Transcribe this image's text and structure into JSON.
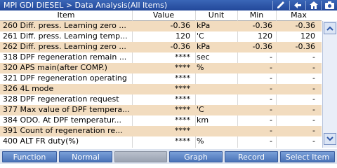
{
  "titlebar": {
    "breadcrumb": "MPI   GDI   DIESEL > Data Analysis(All Items)"
  },
  "columns": {
    "item": "Item",
    "value": "Value",
    "unit": "Unit",
    "min": "Min",
    "max": "Max"
  },
  "rows": [
    {
      "item": "260 Diff. press. Learning zero ...",
      "value": "-0.36",
      "unit": "kPa",
      "min": "-0.36",
      "max": "-0.36"
    },
    {
      "item": "261 Diff. press. Learning temp...",
      "value": "120",
      "unit": "'C",
      "min": "120",
      "max": "120"
    },
    {
      "item": "262 Diff. press. Learning zero ...",
      "value": "-0.36",
      "unit": "kPa",
      "min": "-0.36",
      "max": "-0.36"
    },
    {
      "item": "318 DPF regeneration remain ...",
      "value": "****",
      "unit": "sec",
      "min": "-",
      "max": "-"
    },
    {
      "item": "320 APS main(after COMP.)",
      "value": "****",
      "unit": "%",
      "min": "-",
      "max": "-"
    },
    {
      "item": "321 DPF regeneration operating",
      "value": "****",
      "unit": "",
      "min": "-",
      "max": "-"
    },
    {
      "item": "326 4L mode",
      "value": "****",
      "unit": "",
      "min": "-",
      "max": "-"
    },
    {
      "item": "328 DPF regeneration request",
      "value": "****",
      "unit": "",
      "min": "-",
      "max": "-"
    },
    {
      "item": "377 Max value of DPF tempera...",
      "value": "****",
      "unit": "'C",
      "min": "-",
      "max": "-"
    },
    {
      "item": "384 ODO. At DPF temperatur...",
      "value": "****",
      "unit": "km",
      "min": "-",
      "max": "-"
    },
    {
      "item": "391 Count of regeneration re...",
      "value": "****",
      "unit": "",
      "min": "-",
      "max": "-"
    },
    {
      "item": "400 ALT FR duty(%)",
      "value": "****",
      "unit": "%",
      "min": "-",
      "max": "-"
    }
  ],
  "footer": {
    "buttons": [
      {
        "label": "Function"
      },
      {
        "label": "Normal"
      },
      {
        "label": ""
      },
      {
        "label": "Graph"
      },
      {
        "label": "Record"
      },
      {
        "label": "Select Item"
      }
    ]
  },
  "icons": {
    "edit": "pencil-icon",
    "back": "back-arrow-icon",
    "home": "home-icon",
    "camera": "camera-icon",
    "scroll_up": "chevron-up-icon",
    "scroll_down": "chevron-down-icon"
  },
  "colors": {
    "title_bar": "#2f57a8",
    "row_highlight": "#f2dcbf",
    "button": "#5a82c4"
  }
}
